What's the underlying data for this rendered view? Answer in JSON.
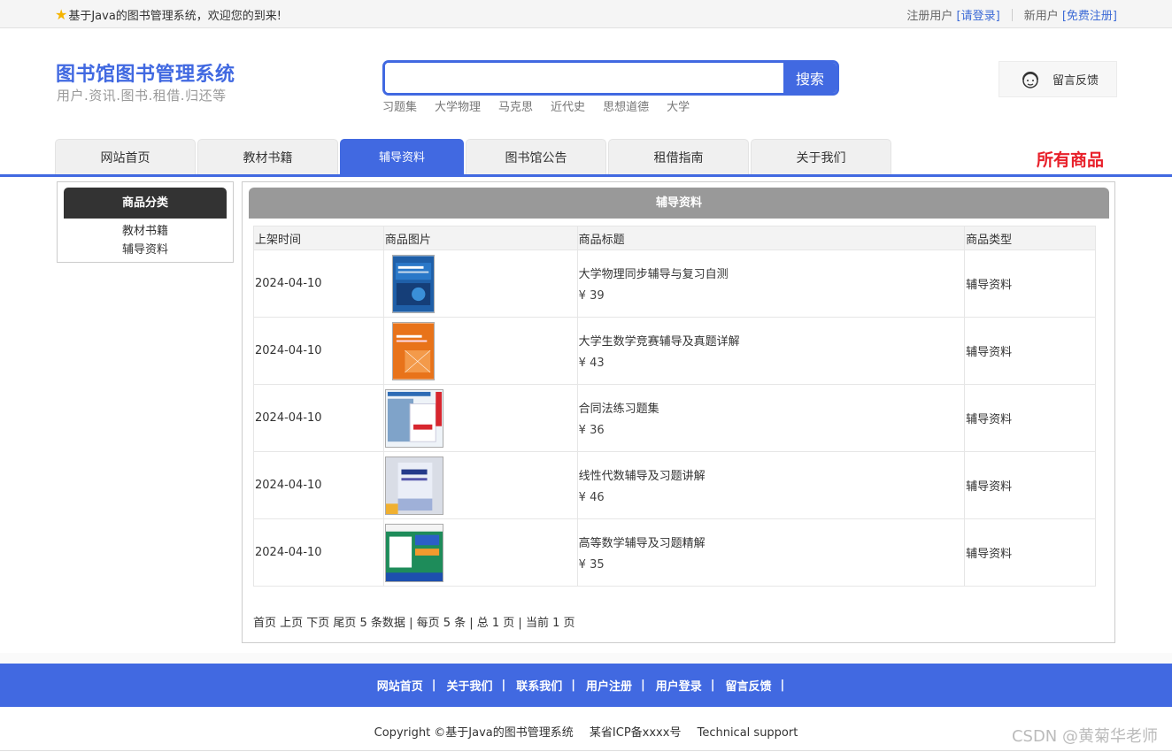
{
  "topbar": {
    "welcome": "基于Java的图书管理系统，欢迎您的到来!",
    "register_user_label": "注册用户",
    "login_link": "[请登录]",
    "new_user_label": "新用户",
    "signup_link": "[免费注册]"
  },
  "header": {
    "logo_title": "图书馆图书管理系统",
    "logo_subtitle": "用户.资讯.图书.租借.归还等",
    "search_placeholder": "",
    "search_button": "搜索",
    "hot_words": [
      "习题集",
      "大学物理",
      "马克思",
      "近代史",
      "思想道德",
      "大学"
    ],
    "feedback": "留言反馈"
  },
  "nav": {
    "tabs": [
      "网站首页",
      "教材书籍",
      "辅导资料",
      "图书馆公告",
      "租借指南",
      "关于我们"
    ],
    "active_index": 2,
    "all_goods": "所有商品"
  },
  "sidebar": {
    "title": "商品分类",
    "items": [
      "教材书籍",
      "辅导资料"
    ]
  },
  "main": {
    "title": "辅导资料",
    "columns": [
      "上架时间",
      "商品图片",
      "商品标题",
      "商品类型"
    ],
    "rows": [
      {
        "date": "2024-04-10",
        "title": "大学物理同步辅导与复习自测",
        "price": "¥ 39",
        "type": "辅导资料"
      },
      {
        "date": "2024-04-10",
        "title": "大学生数学竞赛辅导及真题详解",
        "price": "¥ 43",
        "type": "辅导资料"
      },
      {
        "date": "2024-04-10",
        "title": "合同法练习题集",
        "price": "¥ 36",
        "type": "辅导资料"
      },
      {
        "date": "2024-04-10",
        "title": "线性代数辅导及习题讲解",
        "price": "¥ 46",
        "type": "辅导资料"
      },
      {
        "date": "2024-04-10",
        "title": "高等数学辅导及习题精解",
        "price": "¥ 35",
        "type": "辅导资料"
      }
    ],
    "pager": "首页 上页 下页 尾页 5 条数据 | 每页 5 条 | 总 1 页 | 当前 1 页"
  },
  "footer": {
    "links": [
      "网站首页",
      "关于我们",
      "联系我们",
      "用户注册",
      "用户登录",
      "留言反馈"
    ],
    "copyright": "Copyright ©基于Java的图书管理系统",
    "icp": "某省ICP备xxxx号",
    "support": "Technical support",
    "watermark": "CSDN @黄菊华老师"
  },
  "colors": {
    "accent": "#4169e1",
    "highlight_red": "#e8202a",
    "panel_gray": "#999999"
  }
}
